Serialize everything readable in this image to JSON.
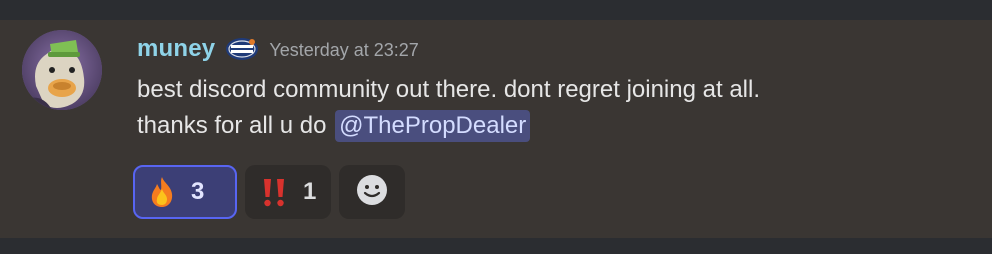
{
  "message": {
    "author": "muney",
    "badge_icon": "march-madness-badge-icon",
    "timestamp": "Yesterday at 23:27",
    "line1": "best discord community out there. dont regret joining at all.",
    "line2_prefix": "thanks for all u do",
    "mention": "@ThePropDealer"
  },
  "reactions": [
    {
      "emoji": "fire-emoji-icon",
      "count": "3",
      "active": true
    },
    {
      "emoji": "double-exclamation-emoji-icon",
      "count": "1",
      "active": false
    }
  ],
  "add_reaction_icon": "add-reaction-smiley-icon",
  "colors": {
    "username": "#8fd3e8",
    "mention_bg": "#4a4e7e",
    "active_reaction_border": "#5865f2",
    "message_bg": "#3a3633"
  }
}
